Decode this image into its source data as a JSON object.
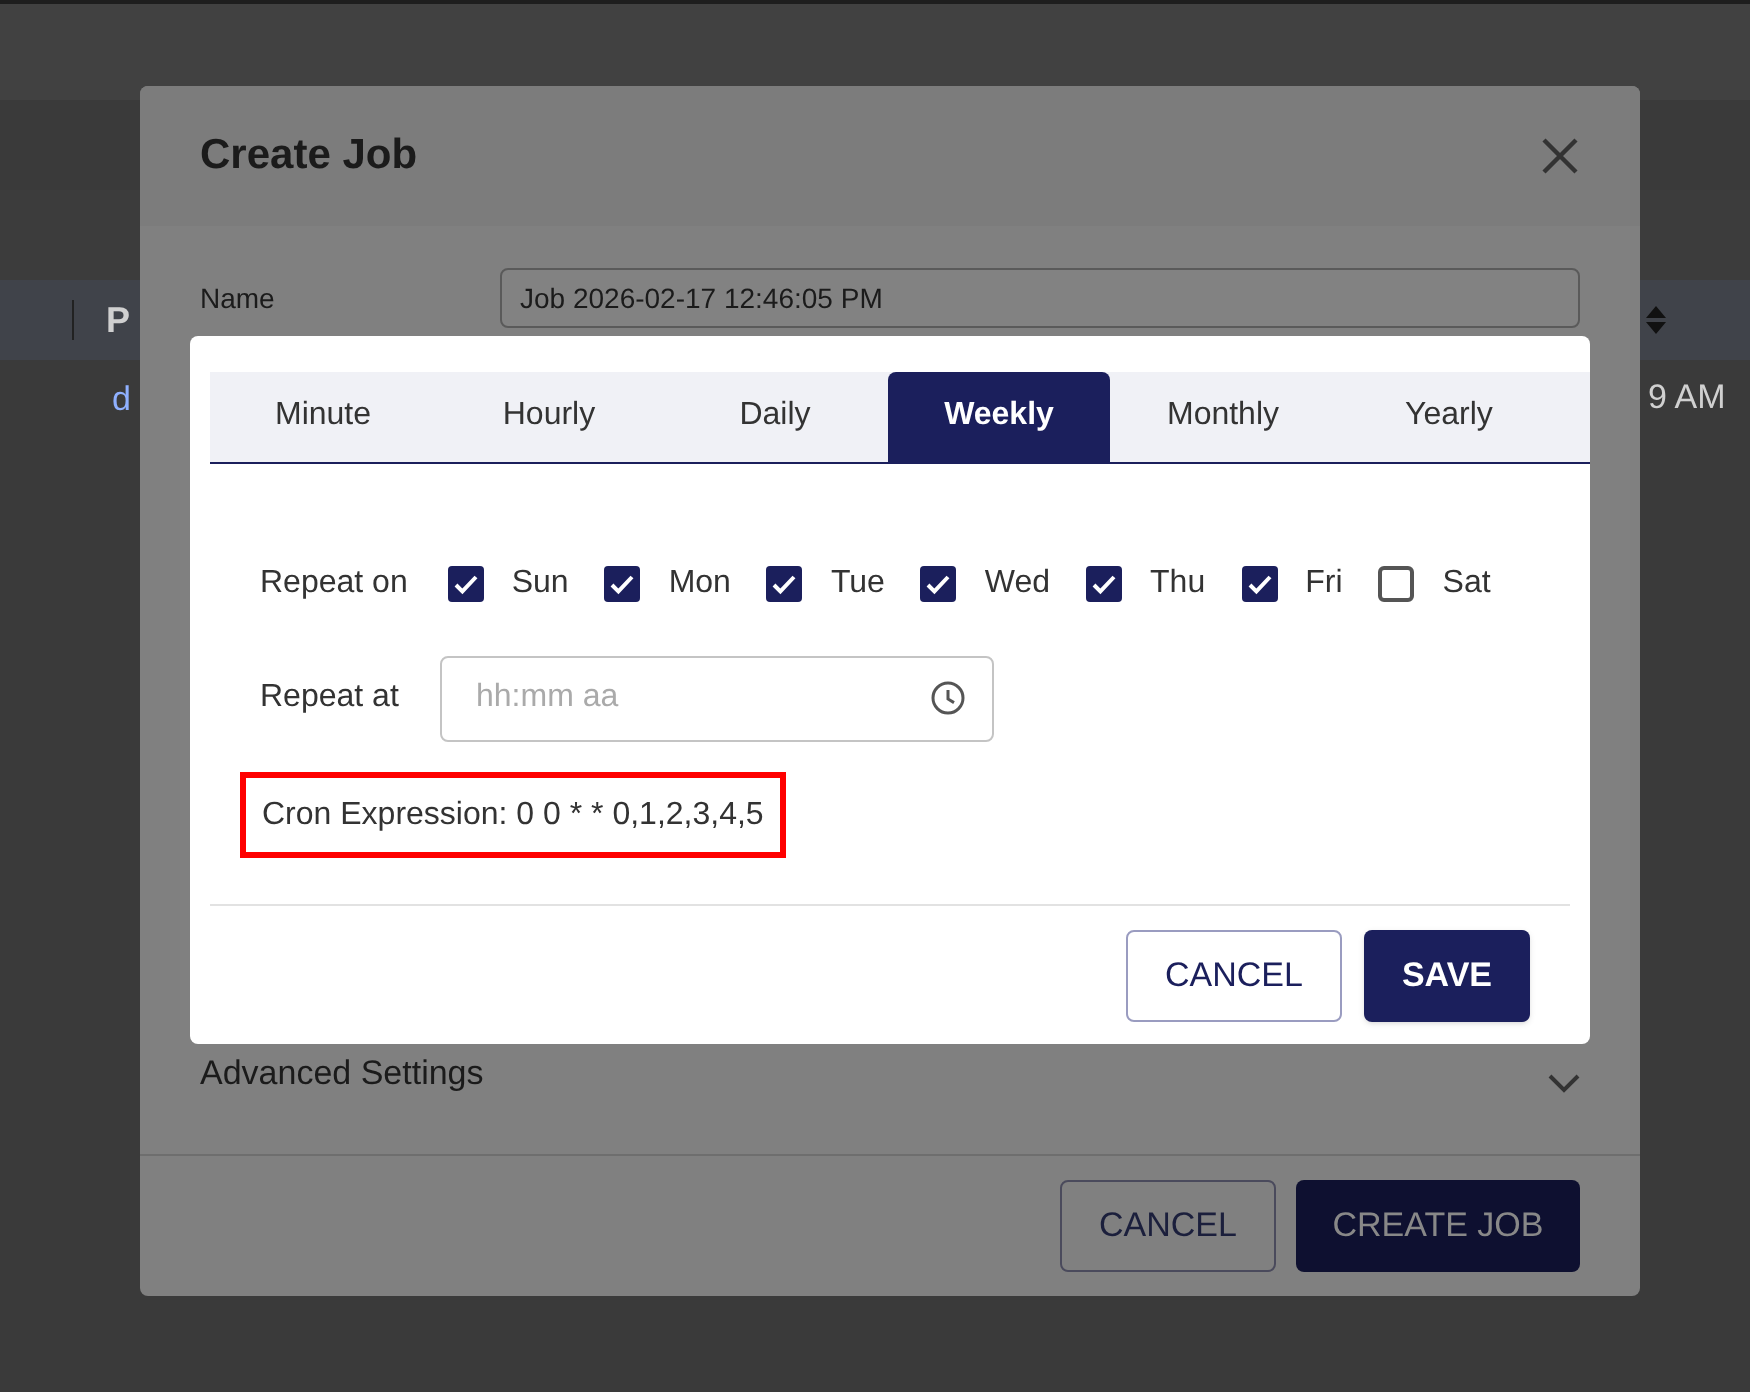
{
  "background_page": {
    "table_header": "P",
    "row_cells": [
      "d",
      "9 AM"
    ]
  },
  "create_job_dialog": {
    "title": "Create Job",
    "name_label": "Name",
    "name_value": "Job 2026-02-17 12:46:05 PM",
    "advanced_settings": "Advanced Settings",
    "buttons": [
      "CANCEL",
      "CREATE JOB"
    ]
  },
  "schedule_dialog": {
    "tabs": [
      {
        "label": "Minute",
        "selected": false
      },
      {
        "label": "Hourly",
        "selected": false
      },
      {
        "label": "Daily",
        "selected": false
      },
      {
        "label": "Weekly",
        "selected": true
      },
      {
        "label": "Monthly",
        "selected": false
      },
      {
        "label": "Yearly",
        "selected": false
      }
    ],
    "repeat_on_label": "Repeat on",
    "days": [
      {
        "label": "Sun",
        "checked": true
      },
      {
        "label": "Mon",
        "checked": true
      },
      {
        "label": "Tue",
        "checked": true
      },
      {
        "label": "Wed",
        "checked": true
      },
      {
        "label": "Thu",
        "checked": true
      },
      {
        "label": "Fri",
        "checked": true
      },
      {
        "label": "Sat",
        "checked": false
      }
    ],
    "repeat_at_label": "Repeat at",
    "repeat_at_placeholder": "hh:mm aa",
    "cron_expression": "Cron Expression: 0 0 * * 0,1,2,3,4,5",
    "buttons": [
      "CANCEL",
      "SAVE"
    ]
  }
}
